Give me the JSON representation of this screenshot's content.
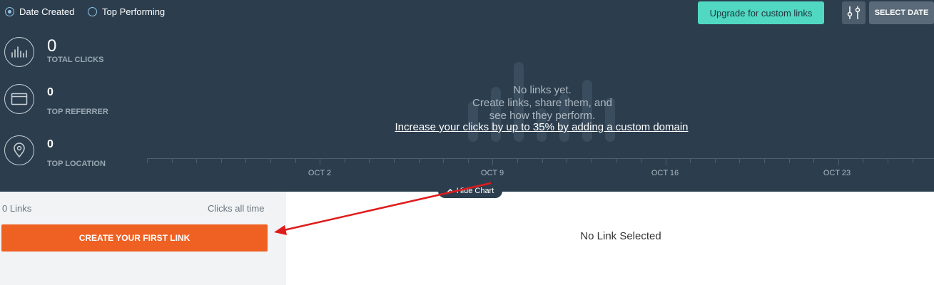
{
  "sort": {
    "date_created": "Date Created",
    "top_performing": "Top Performing"
  },
  "header": {
    "upgrade_label": "Upgrade for custom links",
    "filter_icon": "sliders-icon",
    "select_date_label": "SELECT DATE"
  },
  "stats": {
    "total_clicks": {
      "value": "0",
      "label": "TOTAL CLICKS",
      "icon": "bar-chart-icon"
    },
    "top_referrer": {
      "value": "0",
      "label": "TOP REFERRER",
      "icon": "browser-window-icon"
    },
    "top_location": {
      "value": "0",
      "label": "TOP LOCATION",
      "icon": "map-pin-icon"
    }
  },
  "chart": {
    "empty_line1": "No links yet.",
    "empty_line2": "Create links, share them, and",
    "empty_line3": "see how they perform.",
    "upsell_link": "Increase your clicks by up to 35% by adding a custom domain",
    "dates": [
      "OCT 2",
      "OCT 9",
      "OCT 16",
      "OCT 23"
    ],
    "hide_label": "Hide Chart"
  },
  "list": {
    "count_label": "0 Links",
    "clicks_label": "Clicks all time",
    "create_button": "CREATE YOUR FIRST LINK"
  },
  "detail": {
    "empty": "No Link Selected"
  },
  "colors": {
    "panel_bg": "#2c3e4e",
    "accent_teal": "#50d8c2",
    "create_orange": "#ee6123",
    "annotation_red": "#e01b1b"
  }
}
